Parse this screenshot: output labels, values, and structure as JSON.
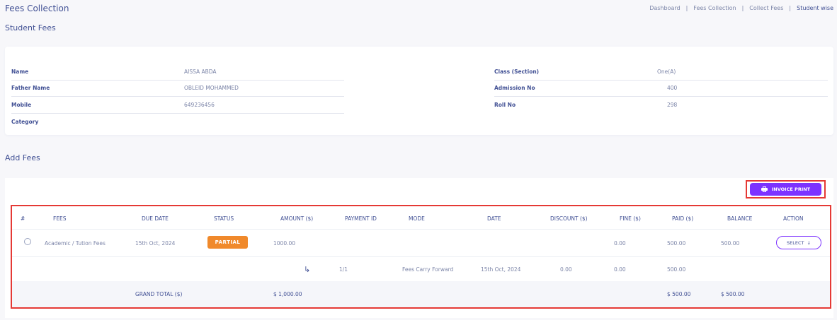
{
  "header": {
    "title": "Fees Collection",
    "breadcrumb": [
      "Dashboard",
      "Fees Collection",
      "Collect Fees",
      "Student wise"
    ]
  },
  "student_section": {
    "title": "Student Fees",
    "left": [
      {
        "label": "Name",
        "value": "AISSA ABDA"
      },
      {
        "label": "Father Name",
        "value": "OBLEID MOHAMMED"
      },
      {
        "label": "Mobile",
        "value": "649236456"
      },
      {
        "label": "Category",
        "value": ""
      }
    ],
    "right": [
      {
        "label": "Class (Section)",
        "value": "One(A)"
      },
      {
        "label": "Admission No",
        "value": "400"
      },
      {
        "label": "Roll No",
        "value": "298"
      }
    ]
  },
  "fees_section": {
    "title": "Add Fees",
    "invoice_button": "INVOICE PRINT",
    "columns": [
      "#",
      "FEES",
      "DUE DATE",
      "STATUS",
      "AMOUNT ($)",
      "PAYMENT ID",
      "MODE",
      "DATE",
      "DISCOUNT ($)",
      "FINE ($)",
      "PAID ($)",
      "BALANCE",
      "ACTION"
    ],
    "row": {
      "fees": "Academic / Tution Fees",
      "due_date": "15th Oct, 2024",
      "status": "PARTIAL",
      "amount": "1000.00",
      "fine": "0.00",
      "paid": "500.00",
      "balance": "500.00",
      "action": "SELECT"
    },
    "sub_row": {
      "payment_id": "1/1",
      "mode": "Fees Carry Forward",
      "date": "15th Oct, 2024",
      "discount": "0.00",
      "fine": "0.00",
      "paid": "500.00"
    },
    "total": {
      "label": "GRAND TOTAL ($)",
      "amount": "$ 1,000.00",
      "paid": "$ 500.00",
      "balance": "$ 500.00"
    }
  },
  "colors": {
    "primary": "#7c32ff",
    "text": "#415094",
    "muted": "#7c85a8",
    "status_partial": "#f0892b",
    "highlight_border": "#e53935"
  }
}
